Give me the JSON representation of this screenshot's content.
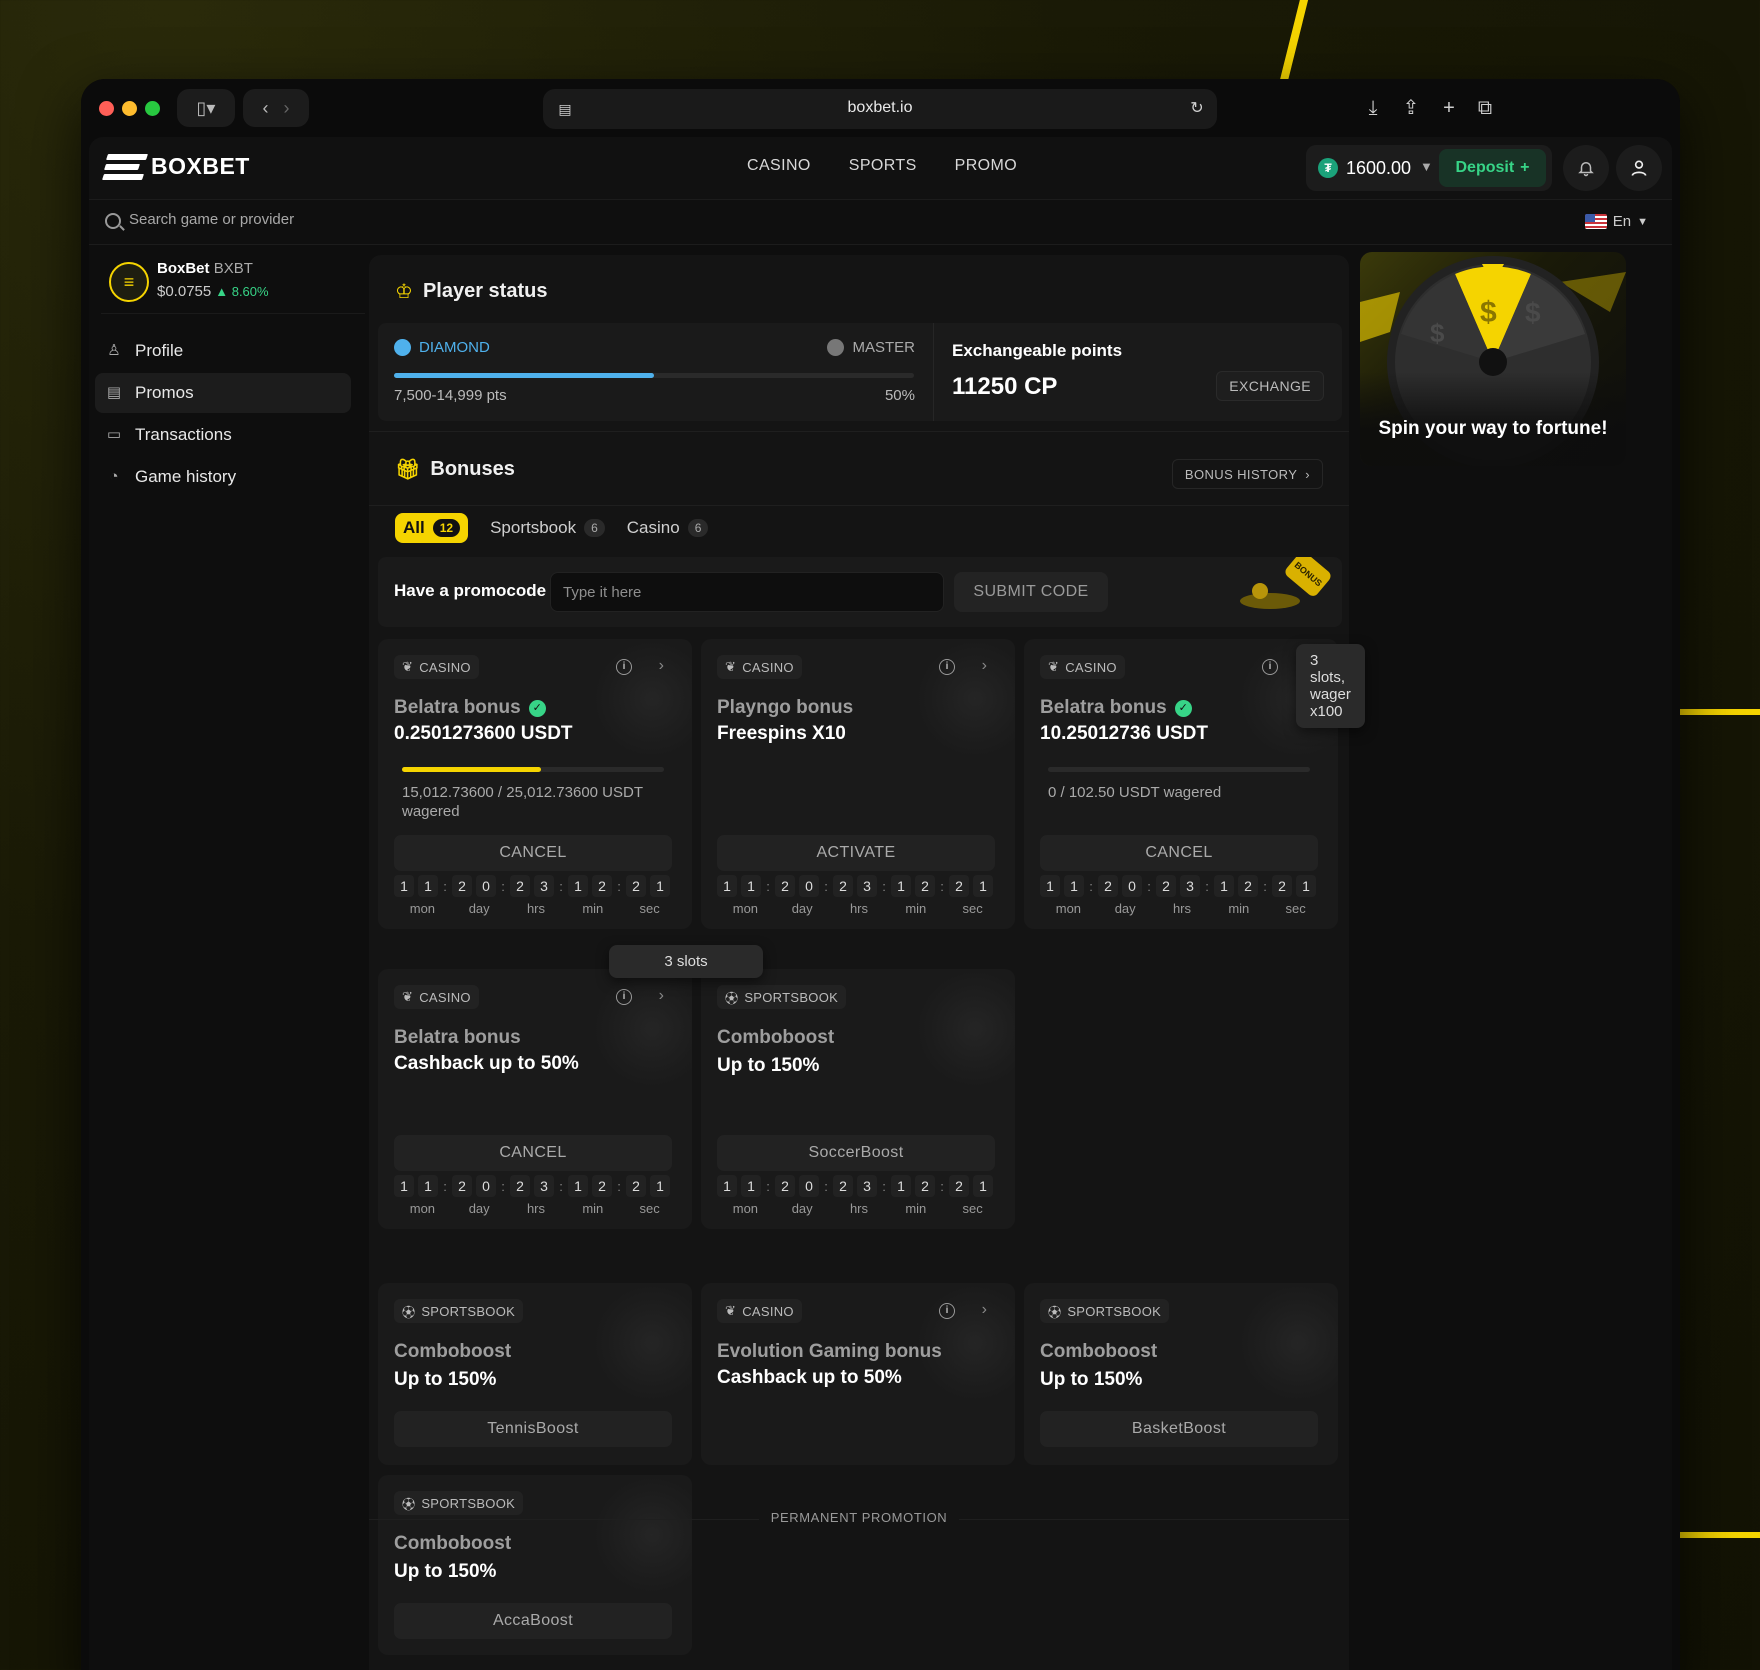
{
  "browser": {
    "url": "boxbet.io"
  },
  "header": {
    "logo": "BOXBET",
    "nav": [
      "CASINO",
      "SPORTS",
      "PROMO"
    ],
    "balance": "1600.00",
    "deposit_label": "Deposit",
    "coin_symbol": "₮"
  },
  "search": {
    "placeholder": "Search game or provider",
    "lang": "En"
  },
  "sidebar": {
    "token_name": "BoxBet",
    "token_symbol": "BXBT",
    "token_price": "$0.0755",
    "token_change": "▲ 8.60%",
    "items": [
      {
        "label": "Profile"
      },
      {
        "label": "Promos"
      },
      {
        "label": "Transactions"
      },
      {
        "label": "Game history"
      }
    ]
  },
  "player_status": {
    "title": "Player status",
    "current_level": "DIAMOND",
    "next_level": "MASTER",
    "progress_percent": 50,
    "points_range": "7,500-14,999 pts",
    "progress_label": "50%",
    "exchange_title": "Exchangeable points",
    "exchange_value": "11250 CP",
    "exchange_button": "EXCHANGE"
  },
  "bonuses": {
    "title": "Bonuses",
    "history_button": "BONUS HISTORY",
    "tabs": [
      {
        "label": "All",
        "count": "12"
      },
      {
        "label": "Sportsbook",
        "count": "6"
      },
      {
        "label": "Casino",
        "count": "6"
      }
    ],
    "promocode_label": "Have a promocode",
    "promocode_placeholder": "Type it here",
    "submit_label": "SUBMIT CODE",
    "tooltip1": "3 slots, wager x100",
    "tooltip2": "3 slots",
    "timer_labels": [
      "mon",
      "day",
      "hrs",
      "min",
      "sec"
    ],
    "timer_digits": [
      "1",
      "1",
      "2",
      "0",
      "2",
      "3",
      "1",
      "2",
      "2",
      "1"
    ],
    "cards": [
      {
        "category": "CASINO",
        "title": "Belatra bonus",
        "subtitle": "0.2501273600 USDT",
        "wagered": "15,012.73600 / 25,012.73600 USDT wagered",
        "progress_percent": 53,
        "button": "CANCEL"
      },
      {
        "category": "CASINO",
        "title": "Playngo bonus",
        "subtitle": "Freespins X10",
        "button": "ACTIVATE"
      },
      {
        "category": "CASINO",
        "title": "Belatra bonus",
        "subtitle": "10.25012736 USDT",
        "wagered": "0 / 102.50 USDT wagered",
        "progress_percent": 0,
        "button": "CANCEL"
      },
      {
        "category": "CASINO",
        "title": "Belatra bonus",
        "subtitle": "Cashback up to 50%",
        "button": "CANCEL"
      },
      {
        "category": "SPORTSBOOK",
        "title": "Comboboost",
        "subtitle": "Up to 150%",
        "button": "SoccerBoost"
      }
    ],
    "permanent_label": "PERMANENT PROMOTION",
    "permanent_cards": [
      {
        "category": "SPORTSBOOK",
        "title": "Comboboost",
        "subtitle": "Up to 150%",
        "button": "TennisBoost"
      },
      {
        "category": "CASINO",
        "title": "Evolution Gaming bonus",
        "subtitle": "Cashback up to 50%"
      },
      {
        "category": "SPORTSBOOK",
        "title": "Comboboost",
        "subtitle": "Up to 150%",
        "button": "BasketBoost"
      },
      {
        "category": "SPORTSBOOK",
        "title": "Comboboost",
        "subtitle": "Up to 150%",
        "button": "AccaBoost"
      }
    ]
  },
  "banner": {
    "text": "Spin your way to fortune!"
  },
  "colors": {
    "accent": "#f5d400",
    "diamond": "#4fb1ec",
    "success": "#37d487"
  },
  "icons": [
    "search-icon",
    "bell-icon",
    "user-icon",
    "gift-icon",
    "crown-icon",
    "info-icon",
    "chevron-right-icon",
    "cherry-icon",
    "soccer-ball-icon"
  ]
}
